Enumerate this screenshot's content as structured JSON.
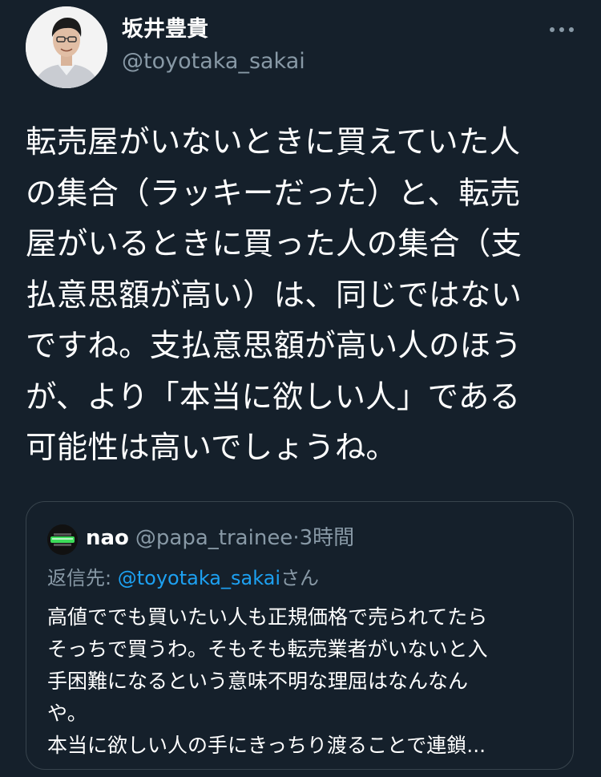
{
  "author": {
    "name": "坂井豊貴",
    "handle": "@toyotaka_sakai"
  },
  "more_icon": "more-horizontal-icon",
  "tweet": {
    "lines": [
      "転売屋がいないときに買えていた人",
      "の集合（ラッキーだった）と、転売",
      "屋がいるときに買った人の集合（支",
      "払意思額が高い）は、同じではない",
      "ですね。支払意思額が高い人のほう",
      "が、より「本当に欲しい人」である",
      "可能性は高いでしょうね。"
    ]
  },
  "quote": {
    "name": "nao",
    "handle": "@papa_trainee",
    "separator": "·",
    "time": "3時間",
    "reply_prefix": "返信先: ",
    "reply_mention": "@toyotaka_sakai",
    "reply_suffix": "さん",
    "lines": [
      "高値ででも買いたい人も正規価格で売られてたら",
      "そっちで買うわ。そもそも転売業者がいないと入",
      "手困難になるという意味不明な理屈はなんなん",
      "や。",
      "本当に欲しい人の手にきっちり渡ることで連鎖..."
    ]
  },
  "colors": {
    "background": "#15202b",
    "secondary_text": "#8899a6",
    "link": "#1da1f2",
    "border": "#38444d"
  }
}
